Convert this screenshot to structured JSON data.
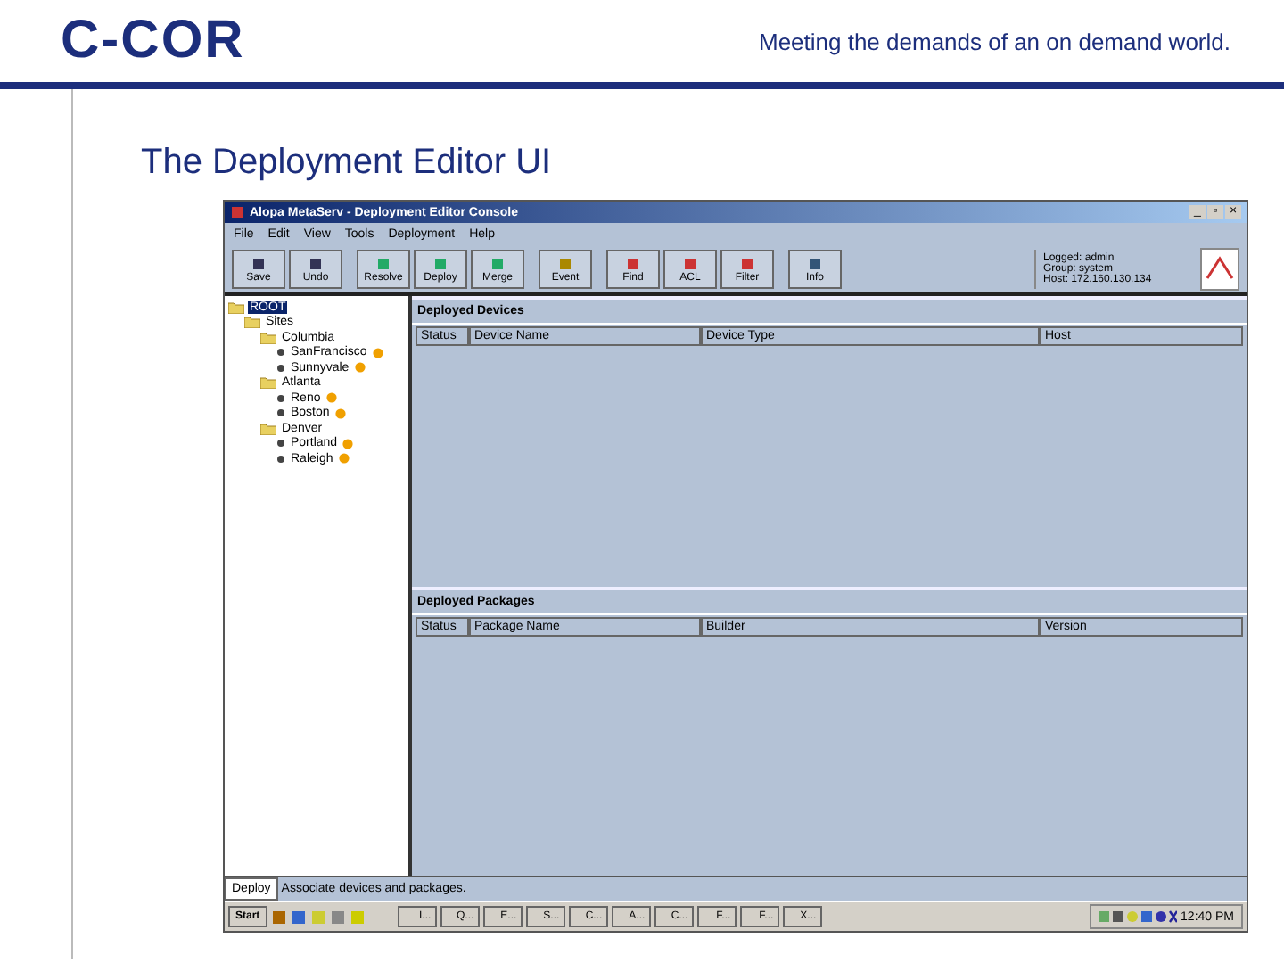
{
  "slide": {
    "logo": "C-COR",
    "tagline": "Meeting the demands of an on demand world.",
    "title": "The Deployment Editor UI"
  },
  "window": {
    "title": "Alopa MetaServ - Deployment Editor Console",
    "controls": [
      "_",
      "▫",
      "×"
    ]
  },
  "menu": [
    "File",
    "Edit",
    "View",
    "Tools",
    "Deployment",
    "Help"
  ],
  "toolbar": [
    [
      "Save",
      "Undo"
    ],
    [
      "Resolve",
      "Deploy",
      "Merge"
    ],
    [
      "Event"
    ],
    [
      "Find",
      "ACL",
      "Filter"
    ],
    [
      "Info"
    ]
  ],
  "session": [
    "Logged: admin",
    "Group: system",
    "Host: 172.160.130.134"
  ],
  "tree": [
    {
      "label": "ROOT",
      "selected": true,
      "children": [
        {
          "label": "Sites",
          "selected": false,
          "children": [
            {
              "label": "Columbia",
              "selected": false,
              "children": [
                {
                  "label": "SanFrancisco",
                  "selected": false,
                  "warning": true
                },
                {
                  "label": "Sunnyvale",
                  "selected": false,
                  "warning": true
                }
              ]
            },
            {
              "label": "Atlanta",
              "selected": false,
              "children": [
                {
                  "label": "Reno",
                  "selected": false,
                  "warning": true
                },
                {
                  "label": "Boston",
                  "selected": false,
                  "warning": true
                }
              ]
            },
            {
              "label": "Denver",
              "selected": false,
              "children": [
                {
                  "label": "Portland",
                  "selected": false,
                  "warning": true
                },
                {
                  "label": "Raleigh",
                  "selected": false,
                  "warning": true
                }
              ]
            }
          ]
        }
      ]
    }
  ],
  "devices": {
    "title": "Deployed Devices",
    "columns": [
      "Status",
      "Device Name",
      "Device Type",
      "Host"
    ]
  },
  "packages": {
    "title": "Deployed Packages",
    "columns": [
      "Status",
      "Package Name",
      "Builder",
      "Version"
    ]
  },
  "status_bar": {
    "tab": "Deploy",
    "message": "Associate devices and packages."
  },
  "taskbar": {
    "start": "Start",
    "tasks": [
      "I...",
      "Q...",
      "E...",
      "S...",
      "C...",
      "A...",
      "C...",
      "F...",
      "F...",
      "X..."
    ],
    "clock": "12:40 PM"
  }
}
